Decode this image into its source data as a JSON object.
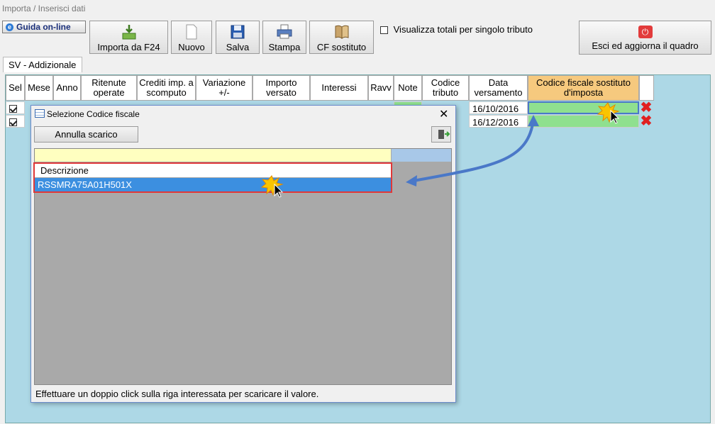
{
  "window": {
    "title": "Importa / Inserisci dati"
  },
  "toolbar": {
    "guida_label": "Guida on-line",
    "buttons": [
      {
        "label": "Importa da F24",
        "icon": "download-icon"
      },
      {
        "label": "Nuovo",
        "icon": "new-document-icon"
      },
      {
        "label": "Salva",
        "icon": "floppy-disk-icon"
      },
      {
        "label": "Stampa",
        "icon": "printer-icon"
      },
      {
        "label": "CF sostituto",
        "icon": "book-icon"
      }
    ],
    "totals_checkbox_label": "Visualizza totali per singolo tributo",
    "totals_checked": false,
    "exit_label": "Esci ed aggiorna il quadro"
  },
  "tabs": [
    {
      "label": "SV - Addizionale",
      "active": true
    }
  ],
  "grid": {
    "columns": [
      "Sel",
      "Mese",
      "Anno",
      "Ritenute operate",
      "Crediti imp. a scomputo",
      "Variazione +/-",
      "Importo versato",
      "Interessi",
      "Ravv",
      "Note",
      "Codice tributo",
      "Data versamento",
      "Codice fiscale sostituto d'imposta"
    ],
    "rows": [
      {
        "selected": true,
        "data_versamento": "16/10/2016"
      },
      {
        "selected": true,
        "data_versamento": "16/12/2016"
      }
    ]
  },
  "dialog": {
    "title": "Selezione Codice fiscale",
    "annulla_label": "Annulla scarico",
    "list_header": "Descrizione",
    "items": [
      "RSSMRA75A01H501X"
    ],
    "status": "Effettuare un doppio click sulla riga interessata per scaricare il valore."
  },
  "colors": {
    "highlight": "#3c8fe0",
    "annotation_red": "#e03838",
    "arrow_blue": "#4a78c8",
    "header_orange": "#f6c97e"
  }
}
